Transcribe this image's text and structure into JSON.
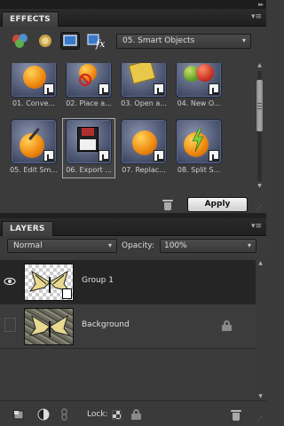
{
  "effects_panel": {
    "title": "EFFECTS",
    "menu_icon": "panel-menu-icon",
    "toolbar_icons": [
      "filters-icon",
      "layer-styles-icon",
      "photo-effects-icon",
      "all-icon"
    ],
    "category_value": "05. Smart Objects",
    "items": [
      {
        "label": "01. Conve..."
      },
      {
        "label": "02. Place a..."
      },
      {
        "label": "03. Open a..."
      },
      {
        "label": "04. New O..."
      },
      {
        "label": "05. Edit Sm..."
      },
      {
        "label": "06. Export ..."
      },
      {
        "label": "07. Replac..."
      },
      {
        "label": "08. Split S..."
      }
    ],
    "selected_index": 5,
    "apply_label": "Apply"
  },
  "layers_panel": {
    "title": "LAYERS",
    "blend_mode": "Normal",
    "opacity_label": "Opacity:",
    "opacity_value": "100%",
    "layers": [
      {
        "name": "Group 1",
        "visible": true,
        "selected": true,
        "locked": false
      },
      {
        "name": "Background",
        "visible": false,
        "selected": false,
        "locked": true
      }
    ],
    "lock_label": "Lock:",
    "bottom_icons": [
      "new-layer-icon",
      "adjustment-layer-icon",
      "link-icon",
      "lock-transparent-icon",
      "lock-all-icon",
      "delete-layer-icon"
    ]
  },
  "colors": {
    "panel_bg": "#3b3b3b",
    "header_bg": "#1f1f1f",
    "selected_row": "#252525",
    "apply_button": "#e8e8e8"
  }
}
